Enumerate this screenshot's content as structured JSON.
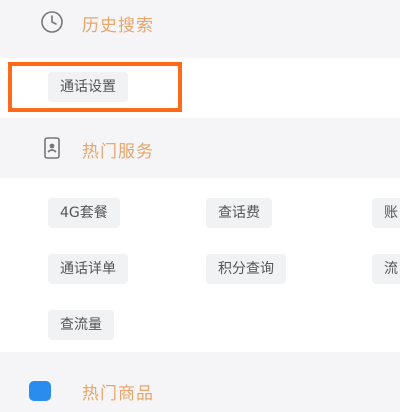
{
  "history": {
    "title": "历史搜索",
    "icon": "clock-icon",
    "items": [
      "通话设置"
    ]
  },
  "hot_services": {
    "title": "热门服务",
    "icon": "phone-card-icon",
    "items": [
      [
        "4G套餐",
        "查话费",
        "账"
      ],
      [
        "通话详单",
        "积分查询",
        "流"
      ],
      [
        "查流量"
      ]
    ]
  },
  "hot_products": {
    "title": "热门商品",
    "icon": "shopping-bag-icon"
  },
  "colors": {
    "section_title": "#e8a66b",
    "highlight_border": "#ff6a1a",
    "chip_bg": "#f1f2f4",
    "chip_text": "#555555",
    "page_bg": "#f5f5f7",
    "panel_bg": "#ffffff"
  }
}
